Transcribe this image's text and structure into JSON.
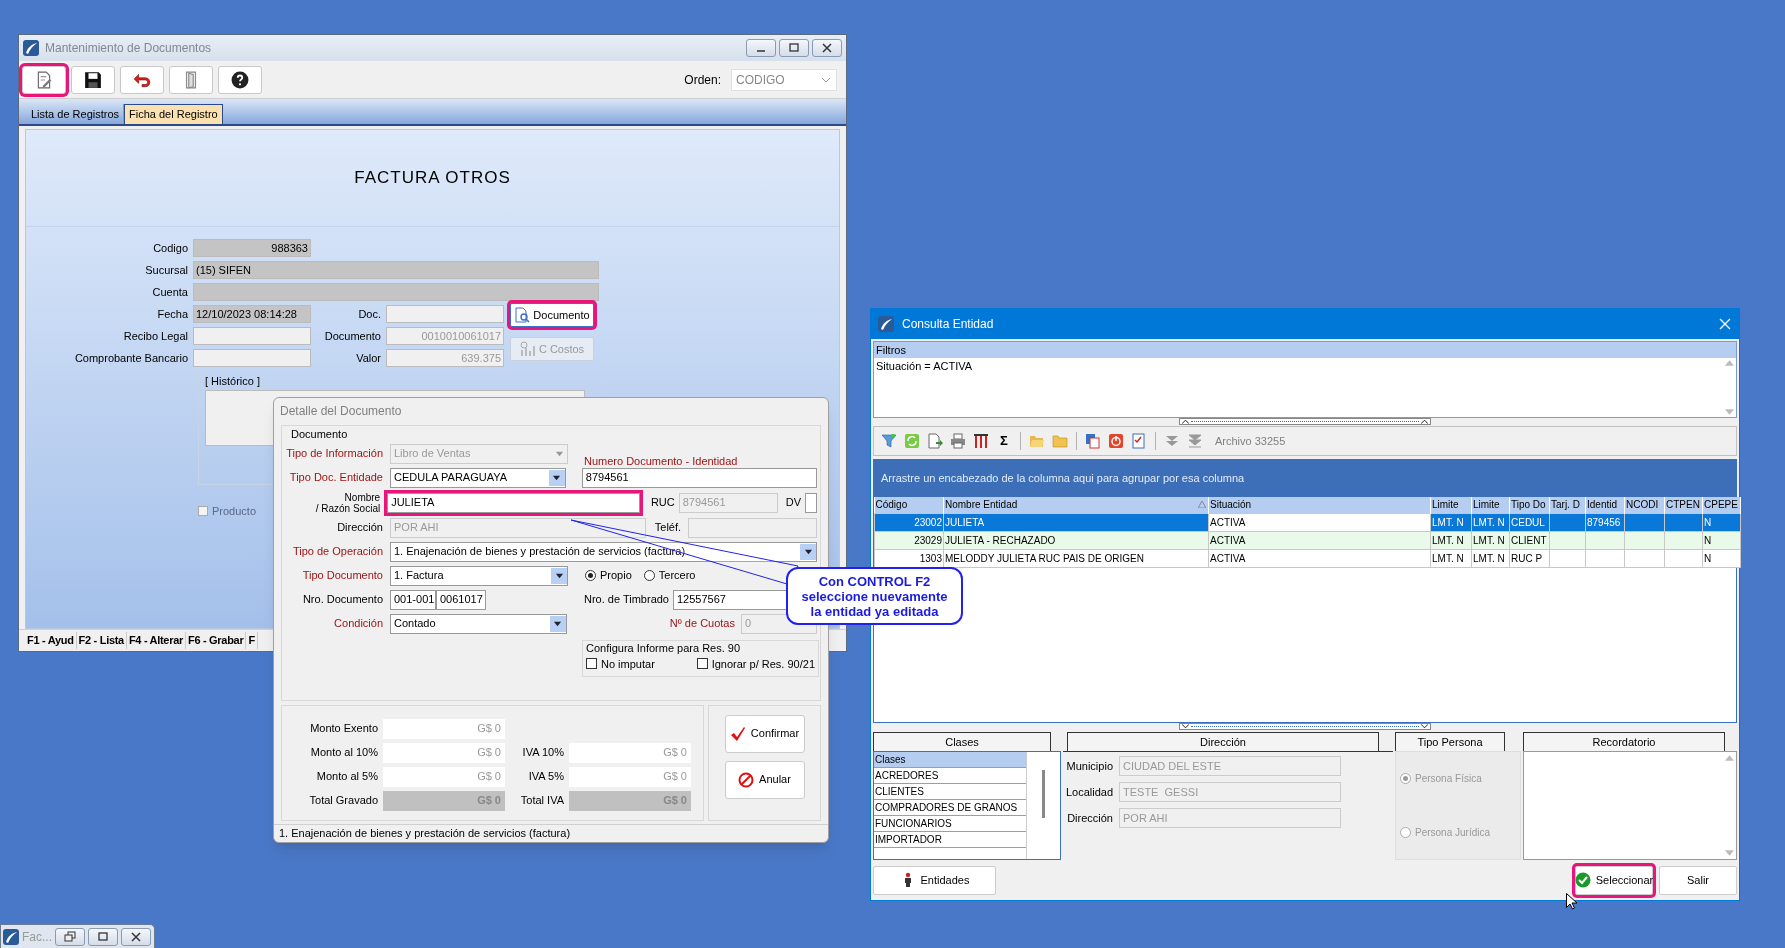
{
  "main_window": {
    "title": "Mantenimiento de Documentos",
    "toolbar": [
      {
        "kind": "edit",
        "highlighted": true
      },
      {
        "kind": "save",
        "highlighted": false
      },
      {
        "kind": "undo",
        "highlighted": false
      },
      {
        "kind": "door",
        "highlighted": false
      },
      {
        "kind": "help",
        "highlighted": false
      }
    ],
    "order": {
      "label": "Orden:",
      "value": "CODIGO"
    },
    "tabs": [
      {
        "label": "Lista de Registros",
        "selected": false
      },
      {
        "label": "Ficha del Registro",
        "selected": true
      }
    ],
    "heading": "FACTURA OTROS",
    "fields": [
      {
        "label": "Codigo",
        "value": "988363",
        "readonly": true
      },
      {
        "label": "Sucursal",
        "value": "(15) SIFEN",
        "readonly": true
      },
      {
        "label": "Cuenta",
        "readonly": true
      },
      {
        "label": "Fecha",
        "value": "12/10/2023 08:14:28",
        "readonly": true
      },
      {
        "label": "Recibo Legal",
        "readonly": false
      },
      {
        "label": "Comprobante Bancario",
        "readonly": false
      }
    ],
    "doc_fields": [
      {
        "label": "Doc."
      },
      {
        "label": "Documento",
        "value": "0010010061017",
        "disabled": true
      },
      {
        "label": "Valor",
        "value": "639.375",
        "disabled": true
      }
    ],
    "side_buttons": [
      {
        "kind": "document",
        "label": "Documento",
        "highlighted": true,
        "disabled": false
      },
      {
        "kind": "costs",
        "label": "C Costos",
        "highlighted": false,
        "disabled": true
      }
    ],
    "history_label": "[ Histórico ]",
    "product": {
      "label": "Producto",
      "checked": false
    },
    "function_keys": [
      "F1 - Ayud",
      "F2 - Lista",
      "F4 - Alterar",
      "F6 - Grabar",
      "F"
    ]
  },
  "detail_dialog": {
    "title": "Detalle del Documento",
    "group": "Documento",
    "tipo_informacion": {
      "label": "Tipo de Información",
      "required": true,
      "value": "Libro de Ventas",
      "disabled": true
    },
    "tipo_doc_entidad": {
      "label": "Tipo Doc. Entidade",
      "required": true,
      "value": "CEDULA PARAGUAYA",
      "disabled": false
    },
    "nombre": {
      "label_lines": [
        "Nombre",
        "/ Razón Social"
      ],
      "required": false,
      "value": "JULIETA",
      "highlighted": true
    },
    "direccion": {
      "label": "Dirección",
      "required": false,
      "value": "POR AHI",
      "disabled": true
    },
    "tipo_operacion": {
      "label": "Tipo de Operación",
      "required": true,
      "value": "1. Enajenación de bienes y prestación de servicios (factura)"
    },
    "tipo_documento": {
      "label": "Tipo Documento",
      "required": true,
      "value": "1. Factura"
    },
    "nro_documento": {
      "label": "Nro. Documento",
      "required": false,
      "establishment": "001-001",
      "number": "0061017"
    },
    "condicion": {
      "label": "Condición",
      "required": true,
      "value": "Contado"
    },
    "identidad": {
      "label": "Numero Documento - Identidad",
      "required": true,
      "value": "8794561"
    },
    "ruc": {
      "label": "RUC",
      "value": "8794561",
      "disabled": true
    },
    "dv": {
      "label": "DV"
    },
    "telefono": {
      "label": "Teléf."
    },
    "origin": [
      {
        "label": "Propio",
        "selected": true
      },
      {
        "label": "Tercero",
        "selected": false
      }
    ],
    "timbrado": {
      "label": "Nro. de Timbrado",
      "required": false,
      "value": "12557567"
    },
    "cuotas": {
      "label": "Nº de Cuotas",
      "required": true,
      "value": "0",
      "disabled": true
    },
    "res90": {
      "title": "Configura Informe para Res. 90",
      "options": [
        {
          "label": "No imputar",
          "checked": false
        },
        {
          "label": "Ignorar p/ Res. 90/21",
          "checked": false
        }
      ]
    },
    "amounts_left": [
      {
        "label": "Monto Exento",
        "value": "G$ 0",
        "total": false
      },
      {
        "label": "Monto al 10%",
        "value": "G$ 0",
        "total": false
      },
      {
        "label": "Monto al 5%",
        "value": "G$ 0",
        "total": false
      },
      {
        "label": "Total Gravado",
        "value": "G$ 0",
        "total": true
      }
    ],
    "amounts_right": [
      {
        "label": "IVA 10%",
        "value": "G$ 0",
        "total": false
      },
      {
        "label": "IVA 5%",
        "value": "G$ 0",
        "total": false
      },
      {
        "label": "Total IVA",
        "value": "G$ 0",
        "total": true
      }
    ],
    "buttons": [
      {
        "kind": "confirm",
        "label": "Confirmar"
      },
      {
        "kind": "cancel",
        "label": "Anular"
      }
    ],
    "status": "1. Enajenación de bienes y prestación de servicios (factura)"
  },
  "callout": {
    "lines": [
      "Con CONTROL F2",
      "seleccione nuevamente",
      "la entidad ya editada"
    ]
  },
  "entity_window": {
    "title": "Consulta Entidad",
    "filters": {
      "title": "Filtros",
      "text": "Situación = ACTIVA"
    },
    "toolbar": [
      {
        "kind": "filter"
      },
      {
        "kind": "refresh"
      },
      {
        "kind": "export"
      },
      {
        "kind": "print"
      },
      {
        "kind": "columns"
      },
      {
        "kind": "sum",
        "label": "Σ"
      },
      {
        "kind": "separator"
      },
      {
        "kind": "open-folder"
      },
      {
        "kind": "folder"
      },
      {
        "kind": "separator"
      },
      {
        "kind": "copy"
      },
      {
        "kind": "stop"
      },
      {
        "kind": "checklist"
      },
      {
        "kind": "separator"
      },
      {
        "kind": "down"
      },
      {
        "kind": "down-end"
      }
    ],
    "record_count": "Archivo 33255",
    "group_hint": "Arrastre un encabezado de la columna aqui para agrupar por esa columna",
    "columns": [
      {
        "label": "Código",
        "sorted": false
      },
      {
        "label": "Nombre Entidad",
        "sorted": true
      },
      {
        "label": "Situación",
        "sorted": false
      },
      {
        "label": "Limite",
        "sorted": false
      },
      {
        "label": "Limite",
        "sorted": false
      },
      {
        "label": "Tipo Do",
        "sorted": false
      },
      {
        "label": "Tarj. D",
        "sorted": false
      },
      {
        "label": "Identid",
        "sorted": false
      },
      {
        "label": "NCODI",
        "sorted": false
      },
      {
        "label": "CTPEN",
        "sorted": false
      },
      {
        "label": "CPEPE",
        "sorted": false
      }
    ],
    "rows": [
      {
        "selected": true,
        "cells": [
          "23002",
          "JULIETA",
          "ACTIVA",
          "LMT. N",
          "LMT. N",
          "CEDUL",
          null,
          "879456",
          null,
          null,
          "N"
        ]
      },
      {
        "selected": false,
        "cells": [
          "23029",
          "JULIETA - RECHAZADO",
          "ACTIVA",
          "LMT. N",
          "LMT. N",
          "CLIENT",
          null,
          null,
          null,
          null,
          "N"
        ]
      },
      {
        "selected": false,
        "cells": [
          "1303",
          "MELODDY JULIETA RUC PAIS DE ORIGEN",
          "ACTIVA",
          "LMT. N",
          "LMT. N",
          "RUC P",
          null,
          null,
          null,
          null,
          "N"
        ]
      }
    ],
    "panels": [
      "Clases",
      "Dirección",
      "Tipo Persona",
      "Recordatorio"
    ],
    "classes": [
      {
        "label": "Clases",
        "selected": true
      },
      {
        "label": "ACREDORES",
        "selected": false
      },
      {
        "label": "CLIENTES",
        "selected": false
      },
      {
        "label": "COMPRADORES DE GRANOS",
        "selected": false
      },
      {
        "label": "FUNCIONARIOS",
        "selected": false
      },
      {
        "label": "IMPORTADOR",
        "selected": false
      }
    ],
    "address": [
      {
        "label": "Municipio",
        "value": "CIUDAD DEL ESTE"
      },
      {
        "label": "Localidad",
        "value": "TESTE  GESSI"
      },
      {
        "label": "Dirección",
        "value": "POR AHI"
      }
    ],
    "person_type": [
      {
        "label": "Persona Física",
        "selected": true
      },
      {
        "label": "Persona Jurídica",
        "selected": false
      }
    ],
    "buttons": [
      {
        "kind": "entities",
        "label": "Entidades",
        "highlighted": false
      },
      {
        "kind": "select",
        "label": "Seleccionar",
        "highlighted": true
      },
      {
        "kind": "exit",
        "label": "Salir",
        "highlighted": false
      }
    ]
  },
  "minimized_window": {
    "title": "Fac..."
  }
}
